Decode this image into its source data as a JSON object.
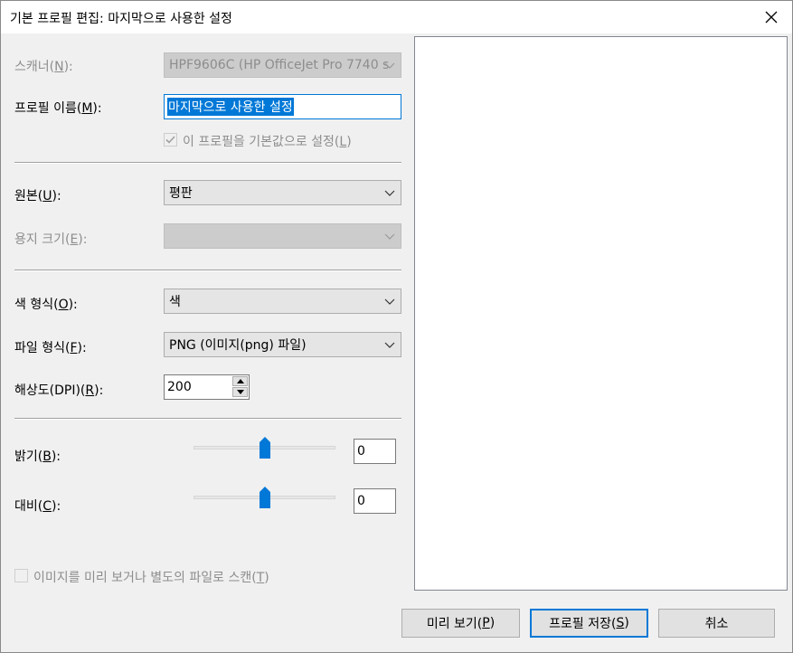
{
  "window": {
    "title": "기본 프로필 편집: 마지막으로 사용한 설정"
  },
  "scanner": {
    "label": "스캐너(",
    "key": "N",
    "suffix": "):",
    "value": "HPF9606C (HP OfficeJet Pro 7740 s"
  },
  "profile_name": {
    "label": "프로필 이름(",
    "key": "M",
    "suffix": "):",
    "value": "마지막으로 사용한 설정"
  },
  "default_checkbox": {
    "label": "이 프로필을 기본값으로 설정(",
    "key": "L",
    "suffix": ")",
    "checked": true
  },
  "source": {
    "label": "원본(",
    "key": "U",
    "suffix": "):",
    "value": "평판"
  },
  "paper_size": {
    "label": "용지 크기(",
    "key": "E",
    "suffix": "):",
    "value": ""
  },
  "color_format": {
    "label": "색 형식(",
    "key": "O",
    "suffix": "):",
    "value": "색"
  },
  "file_type": {
    "label": "파일 형식(",
    "key": "F",
    "suffix": "):",
    "value": "PNG (이미지(png) 파일)"
  },
  "resolution": {
    "label": "해상도(DPI)(",
    "key": "R",
    "suffix": "):",
    "value": "200"
  },
  "brightness": {
    "label": "밝기(",
    "key": "B",
    "suffix": "):",
    "value": "0",
    "level": 0.5
  },
  "contrast": {
    "label": "대비(",
    "key": "C",
    "suffix": "):",
    "value": "0",
    "level": 0.5
  },
  "separate_checkbox": {
    "label": "이미지를 미리 보거나 별도의 파일로 스캔(",
    "key": "T",
    "suffix": ")",
    "checked": false
  },
  "buttons": {
    "preview": {
      "label": "미리 보기(",
      "key": "P",
      "suffix": ")"
    },
    "save": {
      "label": "프로필 저장(",
      "key": "S",
      "suffix": ")"
    },
    "cancel": {
      "label": "취소"
    }
  },
  "colors": {
    "accent": "#0078d7"
  },
  "icons": {
    "close": "close-icon",
    "dropdown": "chevron-down-icon",
    "check": "checkmark-icon"
  }
}
